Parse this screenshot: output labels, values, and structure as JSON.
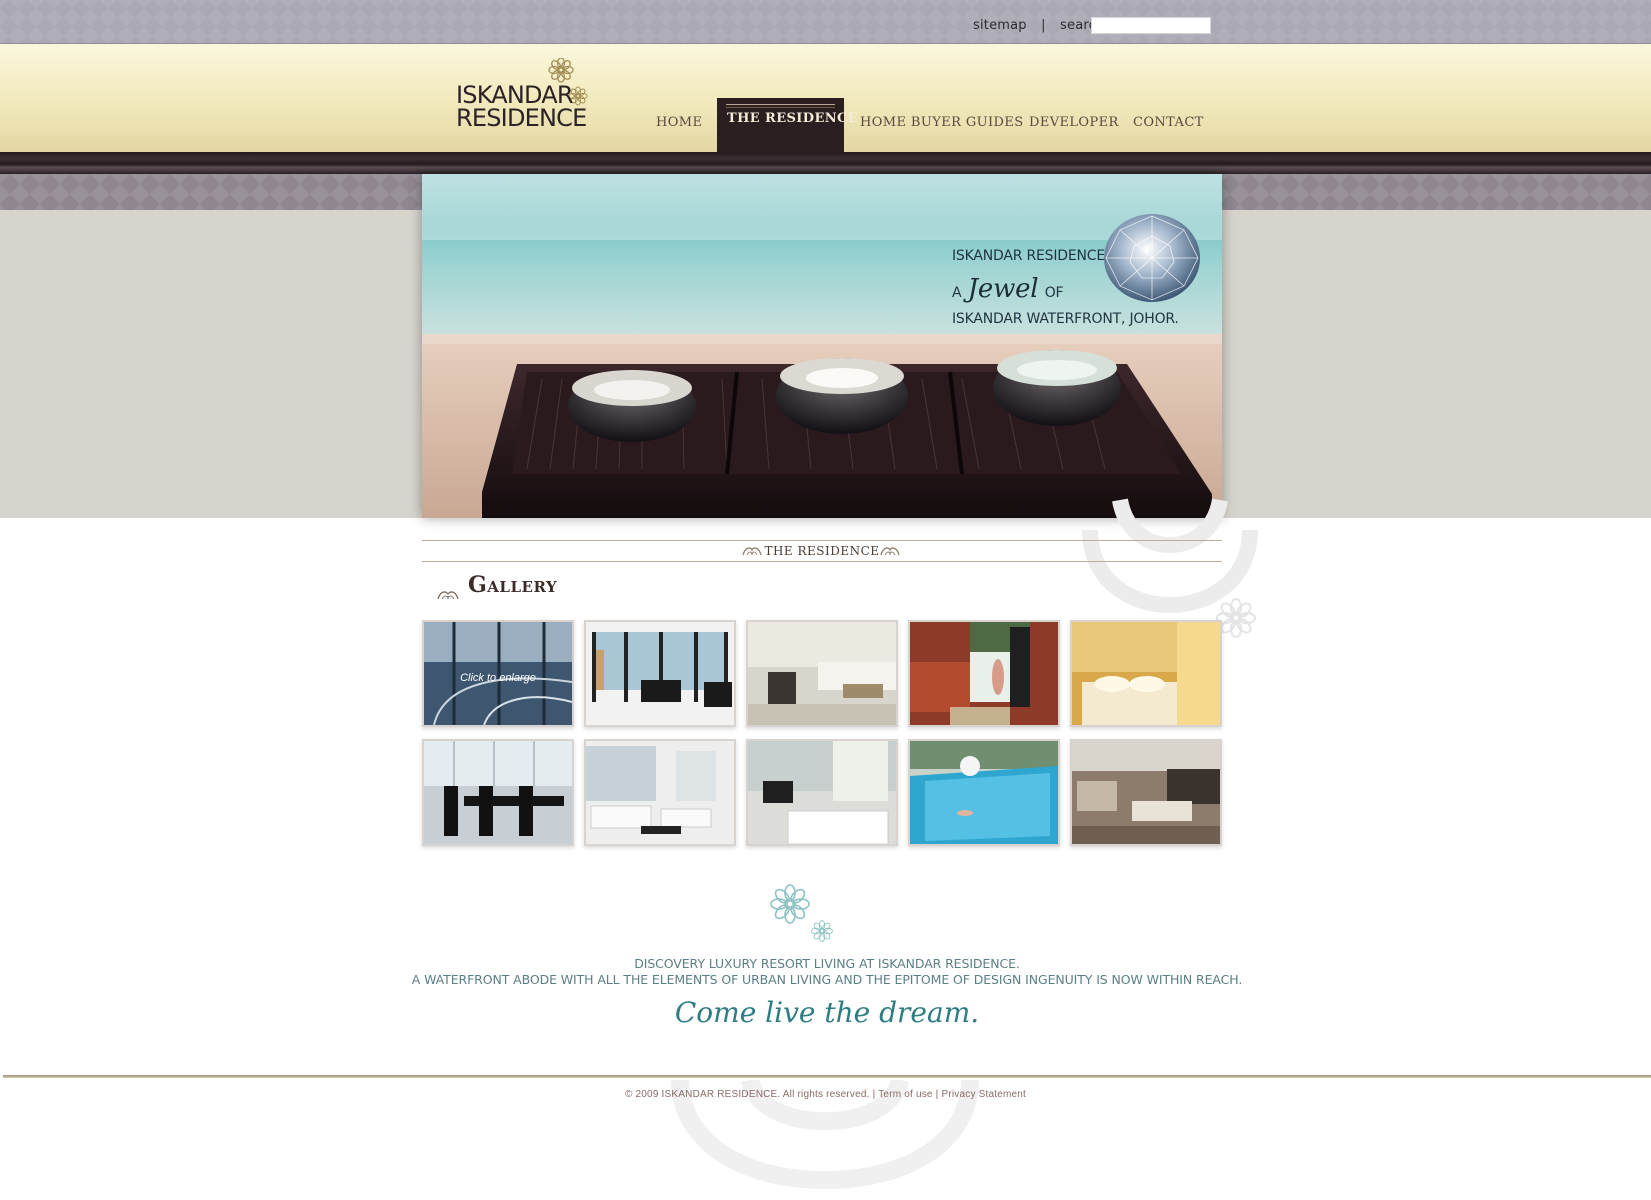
{
  "utility": {
    "sitemap_label": "sitemap",
    "separator": "|",
    "search_label": "search",
    "search_value": ""
  },
  "logo": {
    "line1": "ISKANDAR",
    "line2": "RESIDENCE"
  },
  "nav": {
    "items": [
      {
        "label": "HOME",
        "active": false
      },
      {
        "label": "THE RESIDENCE",
        "active": true
      },
      {
        "label": "HOME BUYER GUIDES",
        "active": false
      },
      {
        "label": "DEVELOPER",
        "active": false
      },
      {
        "label": "CONTACT",
        "active": false
      }
    ]
  },
  "hero": {
    "line1": "ISKANDAR RESIDENCE",
    "line2_prefix": "A",
    "line2_jewel": "Jewel",
    "line2_suffix": "OF",
    "line3": "ISKANDAR WATERFRONT, JOHOR."
  },
  "section": {
    "title": "THE RESIDENCE"
  },
  "gallery": {
    "heading": "Gallery",
    "enlarge_hint": "Click to enlarge",
    "thumbnails": [
      "glass-facade-icon",
      "living-room-sea-view-icon",
      "lounge-sofa-icon",
      "balcony-doorway-icon",
      "bedroom-curtain-icon",
      "dining-room-icon",
      "white-living-room-icon",
      "bedroom-tv-icon",
      "swimming-pool-icon",
      "apartment-interior-icon"
    ]
  },
  "tagline": {
    "line1": "DISCOVERY LUXURY RESORT LIVING AT ISKANDAR RESIDENCE.",
    "line2": "A WATERFRONT ABODE WITH ALL THE ELEMENTS OF URBAN LIVING AND THE EPITOME OF DESIGN INGENUITY IS NOW WITHIN REACH.",
    "script": "Come live the dream."
  },
  "footer": {
    "copyright": "© 2009 ISKANDAR RESIDENCE. All rights reserved.",
    "separator": "|",
    "terms": "Term of use",
    "privacy": "Privacy Statement"
  },
  "colors": {
    "accent_dark": "#2a1e21",
    "header_gold": "#f1e9bc",
    "teal_text": "#2e7d82"
  }
}
